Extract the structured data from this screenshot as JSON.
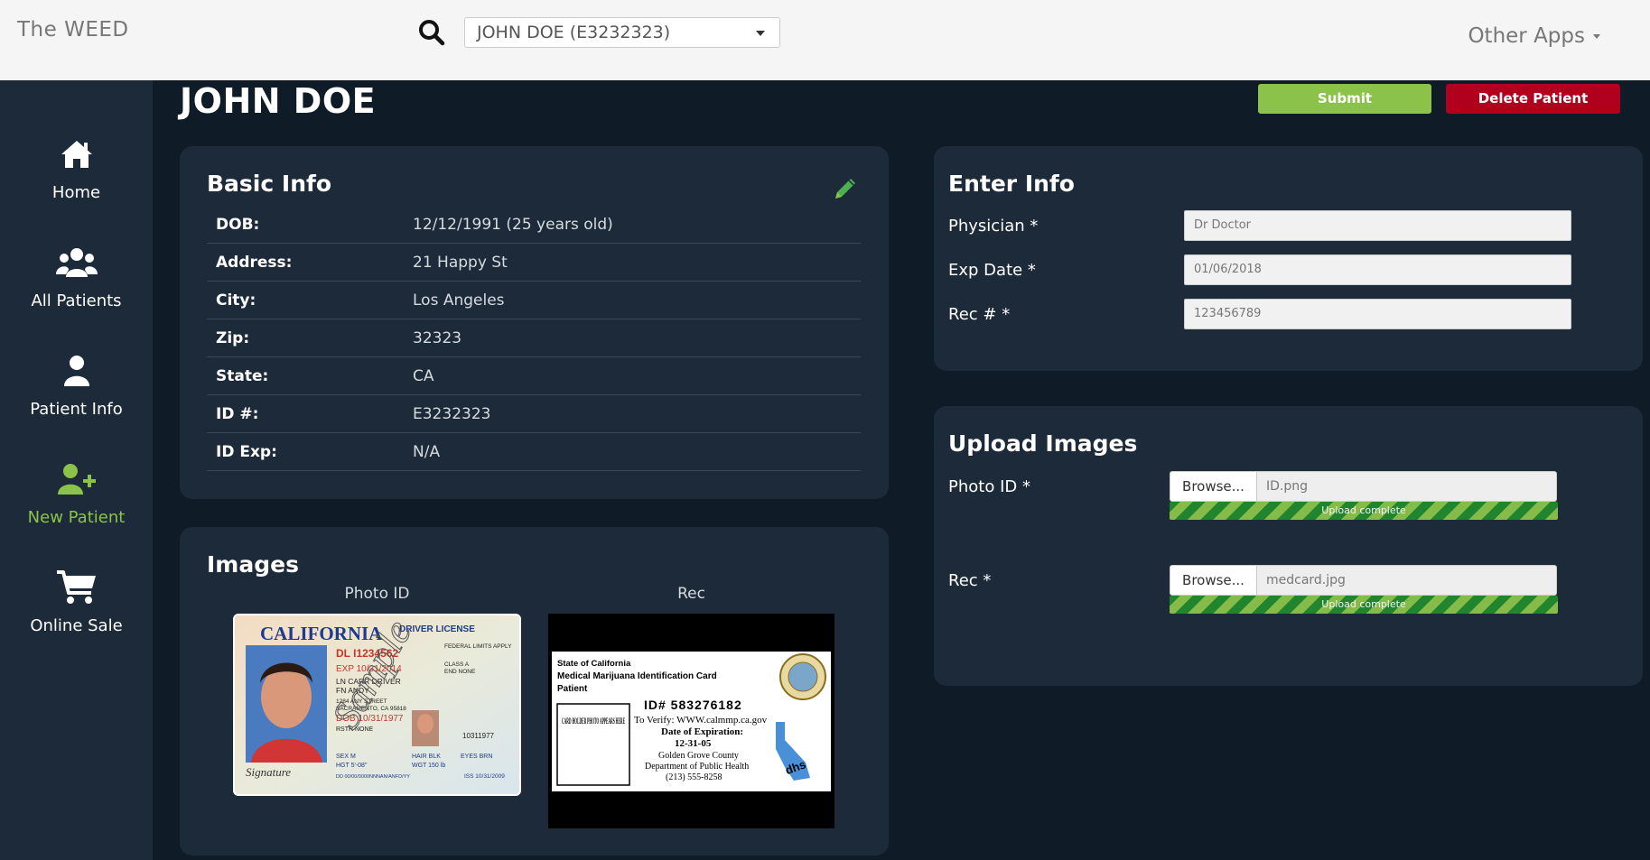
{
  "app": {
    "brand": "The WEED",
    "patient_select_value": "JOHN DOE (E3232323)",
    "other_apps": "Other Apps"
  },
  "sidebar": {
    "items": [
      {
        "label": "Home",
        "icon": "home-icon"
      },
      {
        "label": "All Patients",
        "icon": "users-icon"
      },
      {
        "label": "Patient Info",
        "icon": "user-icon"
      },
      {
        "label": "New Patient",
        "icon": "user-plus-icon"
      },
      {
        "label": "Online Sale",
        "icon": "cart-icon"
      }
    ],
    "active_index": 3
  },
  "header": {
    "title": "JOHN DOE",
    "submit_label": "Submit",
    "delete_label": "Delete Patient"
  },
  "basic_info": {
    "title": "Basic Info",
    "rows": [
      {
        "label": "DOB:",
        "value": "12/12/1991 (25 years old)"
      },
      {
        "label": "Address:",
        "value": "21 Happy St"
      },
      {
        "label": "City:",
        "value": "Los Angeles"
      },
      {
        "label": "Zip:",
        "value": "32323"
      },
      {
        "label": "State:",
        "value": "CA"
      },
      {
        "label": "ID #:",
        "value": "E3232323"
      },
      {
        "label": "ID Exp:",
        "value": "N/A"
      }
    ]
  },
  "images": {
    "title": "Images",
    "photo_id_caption": "Photo ID",
    "rec_caption": "Rec",
    "id_card": {
      "state": "CALIFORNIA",
      "type": "DRIVER LICENSE",
      "dl": "DL I1234562",
      "exp": "EXP 10/31/2014",
      "ln": "LN CARR DRIVER",
      "fn": "FN ANDY",
      "addr1": "1284 ANY STREET",
      "addr2": "SACRAMENTO, CA 95818",
      "dob": "DOB 10/31/1977",
      "rstr": "RSTR NONE",
      "sex": "SEX M",
      "hair": "HAIR BLK",
      "eyes": "EYES BRN",
      "hgt": "HGT 5'-08\"",
      "wgt": "WGT 150 lb",
      "dd": "DD 00/00/0000NNNAN/ANFD/YY",
      "iss": "ISS 10/31/2009",
      "num": "10311977",
      "fed": "FEDERAL LIMITS APPLY",
      "class": "CLASS A",
      "end": "END NONE",
      "sample": "Sample",
      "sig": "Signature"
    },
    "rec_card": {
      "line1": "State of California",
      "line2": "Medical Marijuana Identification Card",
      "line3": "Patient",
      "photo_text": "CARD HOLDER PHOTO APPEARS HERE",
      "id": "ID# 583276182",
      "verify": "To Verify: WWW.calmmp.ca.gov",
      "exp_label": "Date of Expiration:",
      "exp": "12-31-05",
      "county": "Golden Grove County",
      "dept": "Department of Public Health",
      "phone": "(213) 555-8258",
      "dhs": "dhs"
    }
  },
  "enter_info": {
    "title": "Enter Info",
    "fields": [
      {
        "label": "Physician *",
        "value": "Dr Doctor"
      },
      {
        "label": "Exp Date *",
        "value": "01/06/2018"
      },
      {
        "label": "Rec # *",
        "value": "123456789"
      }
    ]
  },
  "upload": {
    "title": "Upload Images",
    "items": [
      {
        "label": "Photo ID *",
        "browse": "Browse...",
        "file": "ID.png",
        "progress_text": "Upload complete",
        "progress": 1.0
      },
      {
        "label": "Rec *",
        "browse": "Browse...",
        "file": "medcard.jpg",
        "progress_text": "Upload complete",
        "progress": 1.0
      }
    ]
  },
  "colors": {
    "accent_green": "#8bc34a",
    "danger_red": "#b0001e",
    "panel_bg": "#1d2a39",
    "page_bg": "#0f1b27"
  }
}
